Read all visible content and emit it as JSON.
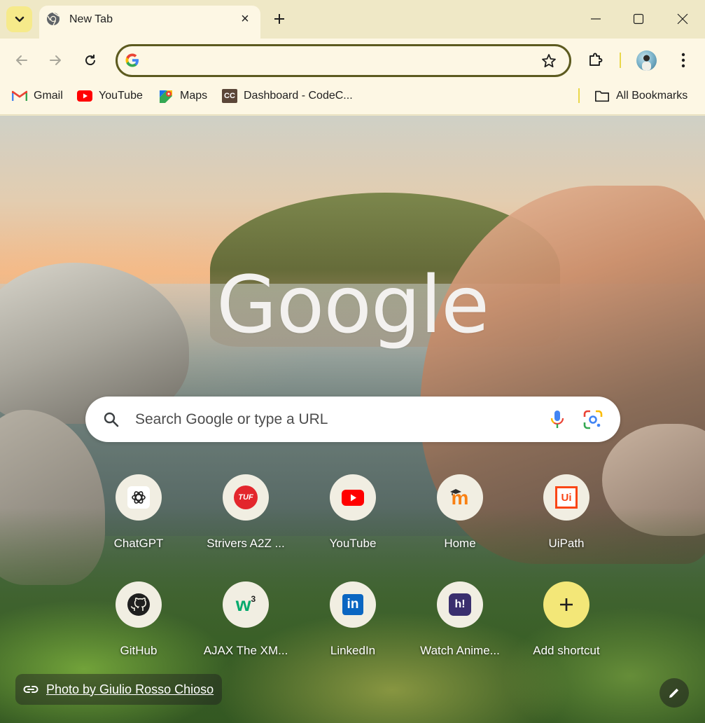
{
  "tab": {
    "title": "New Tab",
    "close_glyph": "×"
  },
  "toolbar": {
    "omnibox_value": "",
    "accent_color": "#5c5a1f"
  },
  "bookmarks": {
    "items": [
      {
        "label": "Gmail",
        "icon": "gmail-icon"
      },
      {
        "label": "YouTube",
        "icon": "youtube-icon"
      },
      {
        "label": "Maps",
        "icon": "maps-icon"
      },
      {
        "label": "Dashboard - CodeC...",
        "icon": "codechef-icon",
        "icon_text": "CC"
      }
    ],
    "all_bookmarks_label": "All Bookmarks"
  },
  "ntp": {
    "logo_text": "Google",
    "search_placeholder": "Search Google or type a URL",
    "shortcuts": [
      {
        "label": "ChatGPT",
        "icon": "chatgpt-icon"
      },
      {
        "label": "Strivers A2Z ...",
        "icon": "tuf-icon",
        "icon_text": "TUF"
      },
      {
        "label": "YouTube",
        "icon": "youtube-icon"
      },
      {
        "label": "Home",
        "icon": "moodle-icon",
        "icon_text": "m"
      },
      {
        "label": "UiPath",
        "icon": "uipath-icon",
        "icon_text": "Ui"
      },
      {
        "label": "GitHub",
        "icon": "github-icon"
      },
      {
        "label": "AJAX The XM...",
        "icon": "w3schools-icon",
        "icon_text": "w3"
      },
      {
        "label": "LinkedIn",
        "icon": "linkedin-icon",
        "icon_text": "in"
      },
      {
        "label": "Watch Anime...",
        "icon": "hianime-icon",
        "icon_text": "h!"
      },
      {
        "label": "Add shortcut",
        "icon": "plus-icon",
        "icon_text": "+"
      }
    ],
    "attribution": "Photo by Giulio Rosso Chioso"
  }
}
